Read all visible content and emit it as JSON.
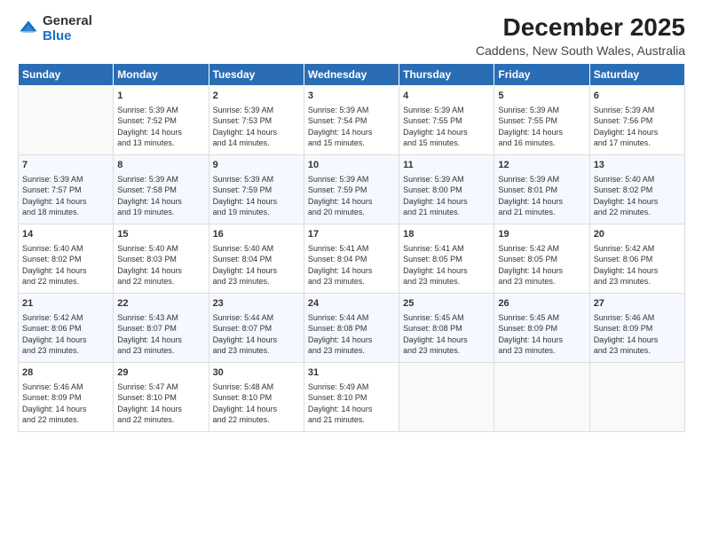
{
  "logo": {
    "general": "General",
    "blue": "Blue"
  },
  "title": "December 2025",
  "subtitle": "Caddens, New South Wales, Australia",
  "days_of_week": [
    "Sunday",
    "Monday",
    "Tuesday",
    "Wednesday",
    "Thursday",
    "Friday",
    "Saturday"
  ],
  "weeks": [
    [
      {
        "day": "",
        "info": ""
      },
      {
        "day": "1",
        "info": "Sunrise: 5:39 AM\nSunset: 7:52 PM\nDaylight: 14 hours\nand 13 minutes."
      },
      {
        "day": "2",
        "info": "Sunrise: 5:39 AM\nSunset: 7:53 PM\nDaylight: 14 hours\nand 14 minutes."
      },
      {
        "day": "3",
        "info": "Sunrise: 5:39 AM\nSunset: 7:54 PM\nDaylight: 14 hours\nand 15 minutes."
      },
      {
        "day": "4",
        "info": "Sunrise: 5:39 AM\nSunset: 7:55 PM\nDaylight: 14 hours\nand 15 minutes."
      },
      {
        "day": "5",
        "info": "Sunrise: 5:39 AM\nSunset: 7:55 PM\nDaylight: 14 hours\nand 16 minutes."
      },
      {
        "day": "6",
        "info": "Sunrise: 5:39 AM\nSunset: 7:56 PM\nDaylight: 14 hours\nand 17 minutes."
      }
    ],
    [
      {
        "day": "7",
        "info": "Sunrise: 5:39 AM\nSunset: 7:57 PM\nDaylight: 14 hours\nand 18 minutes."
      },
      {
        "day": "8",
        "info": "Sunrise: 5:39 AM\nSunset: 7:58 PM\nDaylight: 14 hours\nand 19 minutes."
      },
      {
        "day": "9",
        "info": "Sunrise: 5:39 AM\nSunset: 7:59 PM\nDaylight: 14 hours\nand 19 minutes."
      },
      {
        "day": "10",
        "info": "Sunrise: 5:39 AM\nSunset: 7:59 PM\nDaylight: 14 hours\nand 20 minutes."
      },
      {
        "day": "11",
        "info": "Sunrise: 5:39 AM\nSunset: 8:00 PM\nDaylight: 14 hours\nand 21 minutes."
      },
      {
        "day": "12",
        "info": "Sunrise: 5:39 AM\nSunset: 8:01 PM\nDaylight: 14 hours\nand 21 minutes."
      },
      {
        "day": "13",
        "info": "Sunrise: 5:40 AM\nSunset: 8:02 PM\nDaylight: 14 hours\nand 22 minutes."
      }
    ],
    [
      {
        "day": "14",
        "info": "Sunrise: 5:40 AM\nSunset: 8:02 PM\nDaylight: 14 hours\nand 22 minutes."
      },
      {
        "day": "15",
        "info": "Sunrise: 5:40 AM\nSunset: 8:03 PM\nDaylight: 14 hours\nand 22 minutes."
      },
      {
        "day": "16",
        "info": "Sunrise: 5:40 AM\nSunset: 8:04 PM\nDaylight: 14 hours\nand 23 minutes."
      },
      {
        "day": "17",
        "info": "Sunrise: 5:41 AM\nSunset: 8:04 PM\nDaylight: 14 hours\nand 23 minutes."
      },
      {
        "day": "18",
        "info": "Sunrise: 5:41 AM\nSunset: 8:05 PM\nDaylight: 14 hours\nand 23 minutes."
      },
      {
        "day": "19",
        "info": "Sunrise: 5:42 AM\nSunset: 8:05 PM\nDaylight: 14 hours\nand 23 minutes."
      },
      {
        "day": "20",
        "info": "Sunrise: 5:42 AM\nSunset: 8:06 PM\nDaylight: 14 hours\nand 23 minutes."
      }
    ],
    [
      {
        "day": "21",
        "info": "Sunrise: 5:42 AM\nSunset: 8:06 PM\nDaylight: 14 hours\nand 23 minutes."
      },
      {
        "day": "22",
        "info": "Sunrise: 5:43 AM\nSunset: 8:07 PM\nDaylight: 14 hours\nand 23 minutes."
      },
      {
        "day": "23",
        "info": "Sunrise: 5:44 AM\nSunset: 8:07 PM\nDaylight: 14 hours\nand 23 minutes."
      },
      {
        "day": "24",
        "info": "Sunrise: 5:44 AM\nSunset: 8:08 PM\nDaylight: 14 hours\nand 23 minutes."
      },
      {
        "day": "25",
        "info": "Sunrise: 5:45 AM\nSunset: 8:08 PM\nDaylight: 14 hours\nand 23 minutes."
      },
      {
        "day": "26",
        "info": "Sunrise: 5:45 AM\nSunset: 8:09 PM\nDaylight: 14 hours\nand 23 minutes."
      },
      {
        "day": "27",
        "info": "Sunrise: 5:46 AM\nSunset: 8:09 PM\nDaylight: 14 hours\nand 23 minutes."
      }
    ],
    [
      {
        "day": "28",
        "info": "Sunrise: 5:46 AM\nSunset: 8:09 PM\nDaylight: 14 hours\nand 22 minutes."
      },
      {
        "day": "29",
        "info": "Sunrise: 5:47 AM\nSunset: 8:10 PM\nDaylight: 14 hours\nand 22 minutes."
      },
      {
        "day": "30",
        "info": "Sunrise: 5:48 AM\nSunset: 8:10 PM\nDaylight: 14 hours\nand 22 minutes."
      },
      {
        "day": "31",
        "info": "Sunrise: 5:49 AM\nSunset: 8:10 PM\nDaylight: 14 hours\nand 21 minutes."
      },
      {
        "day": "",
        "info": ""
      },
      {
        "day": "",
        "info": ""
      },
      {
        "day": "",
        "info": ""
      }
    ]
  ]
}
